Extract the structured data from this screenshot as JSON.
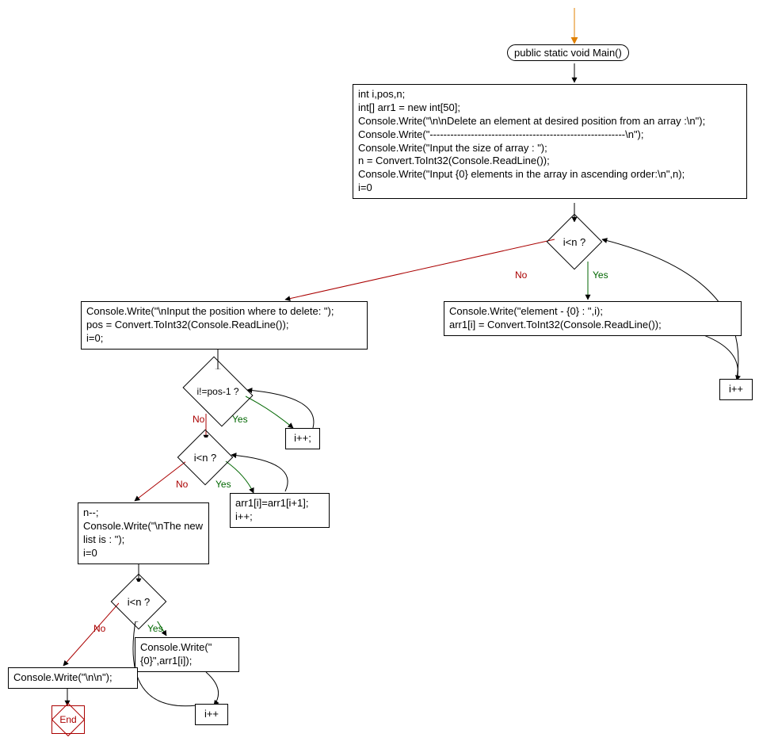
{
  "nodes": {
    "main_label": "public static void Main()",
    "init_block": "int i,pos,n;\nint[] arr1 = new int[50];\nConsole.Write(\"\\n\\nDelete an element at desired position from an array :\\n\");\nConsole.Write(\"---------------------------------------------------------\\n\");\nConsole.Write(\"Input the size of array : \");\nn = Convert.ToInt32(Console.ReadLine());\nConsole.Write(\"Input {0} elements in the array in ascending order:\\n\",n);\ni=0",
    "d1": "i<n ?",
    "loop1_body": "Console.Write(\"element - {0} : \",i);\narr1[i] = Convert.ToInt32(Console.ReadLine());",
    "incr": "i++",
    "incr2": "i++;",
    "pos_block": "Console.Write(\"\\nInput the position where to delete: \");\npos = Convert.ToInt32(Console.ReadLine());\ni=0;",
    "d2": "i!=pos-1 ?",
    "d3": "i<n ?",
    "shift_body": "arr1[i]=arr1[i+1];\ni++;",
    "newlist": "n--;\nConsole.Write(\"\\nThe new list is : \");\ni=0",
    "d4": "i<n ?",
    "print_body": "Console.Write(\" {0}\",arr1[i]);",
    "final_write": "Console.Write(\"\\n\\n\");",
    "end": "End"
  },
  "labels": {
    "no": "No",
    "yes": "Yes"
  }
}
